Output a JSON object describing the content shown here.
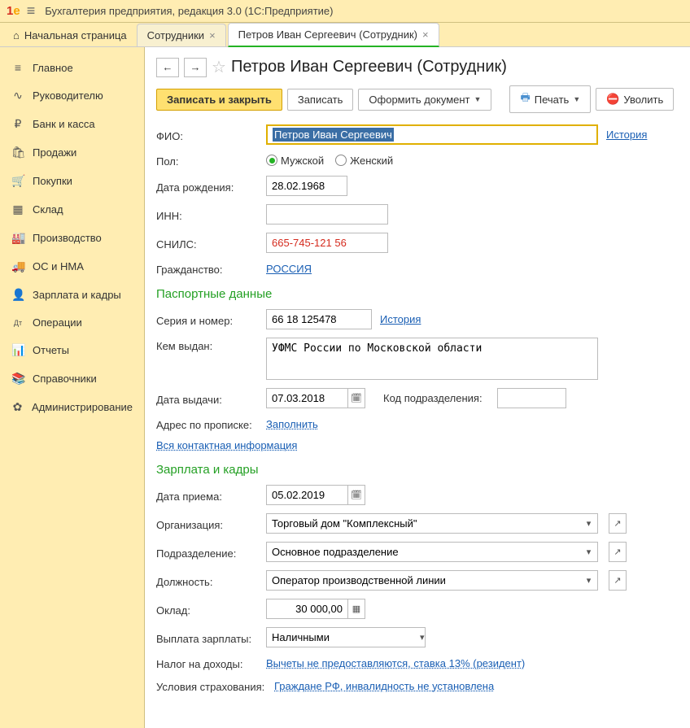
{
  "titlebar": {
    "logo": "1С",
    "title": "Бухгалтерия предприятия, редакция 3.0  (1С:Предприятие)"
  },
  "tabs": {
    "home": "Начальная страница",
    "t1": "Сотрудники",
    "t2": "Петров Иван Сергеевич (Сотрудник)"
  },
  "sidebar": [
    {
      "icon": "≡",
      "label": "Главное"
    },
    {
      "icon": "∿",
      "label": "Руководителю"
    },
    {
      "icon": "₽",
      "label": "Банк и касса"
    },
    {
      "icon": "🛍",
      "label": "Продажи"
    },
    {
      "icon": "🛒",
      "label": "Покупки"
    },
    {
      "icon": "▦",
      "label": "Склад"
    },
    {
      "icon": "🏭",
      "label": "Производство"
    },
    {
      "icon": "🚚",
      "label": "ОС и НМА"
    },
    {
      "icon": "👤",
      "label": "Зарплата и кадры"
    },
    {
      "icon": "Дт",
      "label": "Операции"
    },
    {
      "icon": "📊",
      "label": "Отчеты"
    },
    {
      "icon": "📚",
      "label": "Справочники"
    },
    {
      "icon": "✿",
      "label": "Администрирование"
    }
  ],
  "page": {
    "title": "Петров Иван Сергеевич (Сотрудник)"
  },
  "toolbar": {
    "save_close": "Записать и закрыть",
    "save": "Записать",
    "create_doc": "Оформить документ",
    "print": "Печать",
    "fire": "Уволить"
  },
  "labels": {
    "fio": "ФИО:",
    "history": "История",
    "gender": "Пол:",
    "male": "Мужской",
    "female": "Женский",
    "birthdate": "Дата рождения:",
    "inn": "ИНН:",
    "snils": "СНИЛС:",
    "citizenship": "Гражданство:",
    "passport_section": "Паспортные данные",
    "series_number": "Серия и номер:",
    "issued_by": "Кем выдан:",
    "issue_date": "Дата выдачи:",
    "dept_code": "Код подразделения:",
    "reg_address": "Адрес по прописке:",
    "fill": "Заполнить",
    "all_contact": "Вся контактная информация",
    "hr_section": "Зарплата и кадры",
    "hire_date": "Дата приема:",
    "organization": "Организация:",
    "department": "Подразделение:",
    "position": "Должность:",
    "salary": "Оклад:",
    "payment": "Выплата зарплаты:",
    "tax": "Налог на доходы:",
    "insurance": "Условия страхования:"
  },
  "values": {
    "fio": "Петров Иван Сергеевич",
    "birthdate": "28.02.1968",
    "inn": "",
    "snils": "665-745-121 56",
    "citizenship": "РОССИЯ",
    "series_number": "66 18 125478",
    "issued_by": "УФМС России по Московской области",
    "issue_date": "07.03.2018",
    "dept_code": "",
    "hire_date": "05.02.2019",
    "organization": "Торговый дом \"Комплексный\"",
    "department": "Основное подразделение",
    "position": "Оператор производственной линии",
    "salary": "30 000,00",
    "payment": "Наличными",
    "tax": "Вычеты не предоставляются, ставка 13% (резидент)",
    "insurance": "Граждане РФ, инвалидность не установлена"
  }
}
